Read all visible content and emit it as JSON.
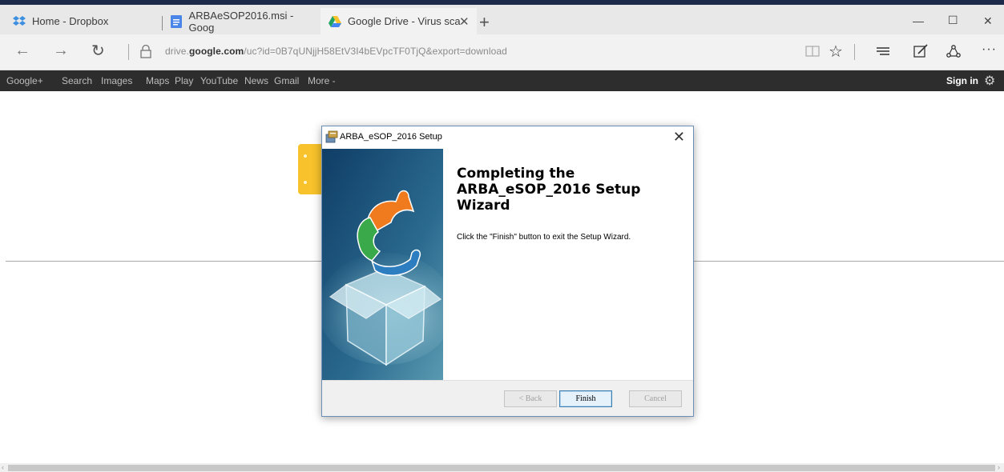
{
  "browser": {
    "tabs": [
      {
        "label": "Home - Dropbox",
        "icon": "dropbox-icon"
      },
      {
        "label": "ARBAeSOP2016.msi - Goog",
        "icon": "document-icon"
      },
      {
        "label": "Google Drive - Virus sca",
        "icon": "google-drive-icon",
        "active": true
      }
    ],
    "address": {
      "prefix": "drive.",
      "domain": "google.com",
      "path": "/uc?id=0B7qUNjjH58EtV3I4bEVpcTF0TjQ&export=download"
    }
  },
  "google_bar": {
    "items": [
      "Google+",
      "Search",
      "Images",
      "Maps",
      "Play",
      "YouTube",
      "News",
      "Gmail",
      "More -"
    ],
    "sign_in": "Sign in"
  },
  "dialog": {
    "title": "ARBA_eSOP_2016 Setup",
    "heading": "Completing the ARBA_eSOP_2016 Setup Wizard",
    "body": "Click the \"Finish\" button to exit the Setup Wizard.",
    "buttons": {
      "back": "< Back",
      "finish": "Finish",
      "cancel": "Cancel"
    }
  },
  "colors": {
    "accent_drive_yellow": "#f7c22b",
    "google_bar_bg": "#2d2d2d",
    "dialog_banner": "#1d4f7a"
  }
}
